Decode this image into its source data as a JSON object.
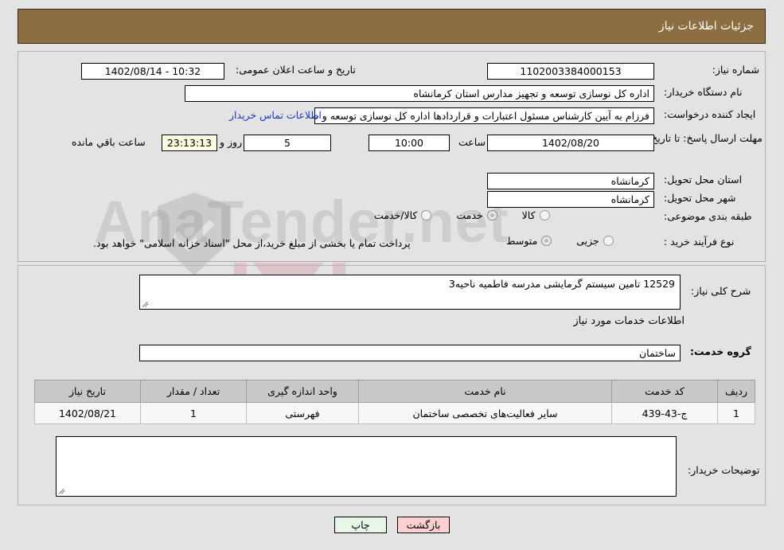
{
  "header": {
    "title": "جزئیات اطلاعات نیاز"
  },
  "watermark": {
    "text": "AnaTender.net"
  },
  "form": {
    "need_number": {
      "label": "شماره نیاز:",
      "value": "1102003384000153"
    },
    "public_announcement": {
      "label": "تاریخ و ساعت اعلان عمومی:",
      "value": "10:32 - 1402/08/14"
    },
    "buyer_org": {
      "label": "نام دستگاه خریدار:",
      "value": "اداره کل نوسازی  توسعه و تجهیز مدارس استان کرمانشاه"
    },
    "request_creator": {
      "label": "ایجاد کننده درخواست:",
      "value": "فرزام به آیین کارشناس مسئول اعتبارات و قراردادها اداره کل نوسازی  توسعه و ت"
    },
    "contact_link": {
      "label": "اطلاعات تماس خریدار"
    },
    "deadline": {
      "label": "مهلت ارسال پاسخ: تا تاریخ:",
      "date": "1402/08/20",
      "hour_label": "ساعت",
      "hour": "10:00",
      "days": "5",
      "days_label": "روز و",
      "countdown": "23:13:13",
      "countdown_label": "ساعت باقي مانده"
    },
    "delivery_province": {
      "label": "استان محل تحویل:",
      "value": "کرمانشاه"
    },
    "delivery_city": {
      "label": "شهر محل تحویل:",
      "value": "کرمانشاه"
    },
    "subject_class": {
      "label": "طبقه بندی موضوعی:",
      "options": [
        {
          "text": "کالا",
          "checked": false
        },
        {
          "text": "خدمت",
          "checked": true
        },
        {
          "text": "کالا/خدمت",
          "checked": false
        }
      ]
    },
    "purchase_process": {
      "label": "نوع فرآیند خرید :",
      "options": [
        {
          "text": "جزیی",
          "checked": false
        },
        {
          "text": "متوسط",
          "checked": true
        }
      ],
      "note": "پرداخت تمام یا بخشی از مبلغ خرید،از محل \"اسناد خزانه اسلامی\" خواهد بود."
    },
    "general_description": {
      "label": "شرح کلی نیاز:",
      "value": "12529 تامین سیستم گرمایشی مدرسه فاطمیه ناحیه3"
    },
    "services_section_title": "اطلاعات خدمات مورد نیاز",
    "service_group": {
      "label": "گروه خدمت:",
      "value": "ساختمان"
    },
    "buyer_comments": {
      "label": "توضیحات خریدار:",
      "value": ""
    }
  },
  "table": {
    "columns": [
      "ردیف",
      "کد خدمت",
      "نام خدمت",
      "واحد اندازه گیری",
      "تعداد / مقدار",
      "تاریخ نیاز"
    ],
    "rows": [
      {
        "index": "1",
        "code": "ج-43-439",
        "name": "سایر فعالیت‌های تخصصی ساختمان",
        "unit": "فهرستی",
        "quantity": "1",
        "need_date": "1402/08/21"
      }
    ]
  },
  "buttons": {
    "print": "چاپ",
    "back": "بازگشت"
  },
  "colors": {
    "header_bar": "#8d6e43",
    "page_background": "#e3e3e3",
    "link": "#1b36c8",
    "countdown_bg": "#fcfce0",
    "print_button_bg": "#e8f6e8",
    "back_button_bg": "#ffd0d0",
    "table_header_bg": "#c8c8c8"
  }
}
